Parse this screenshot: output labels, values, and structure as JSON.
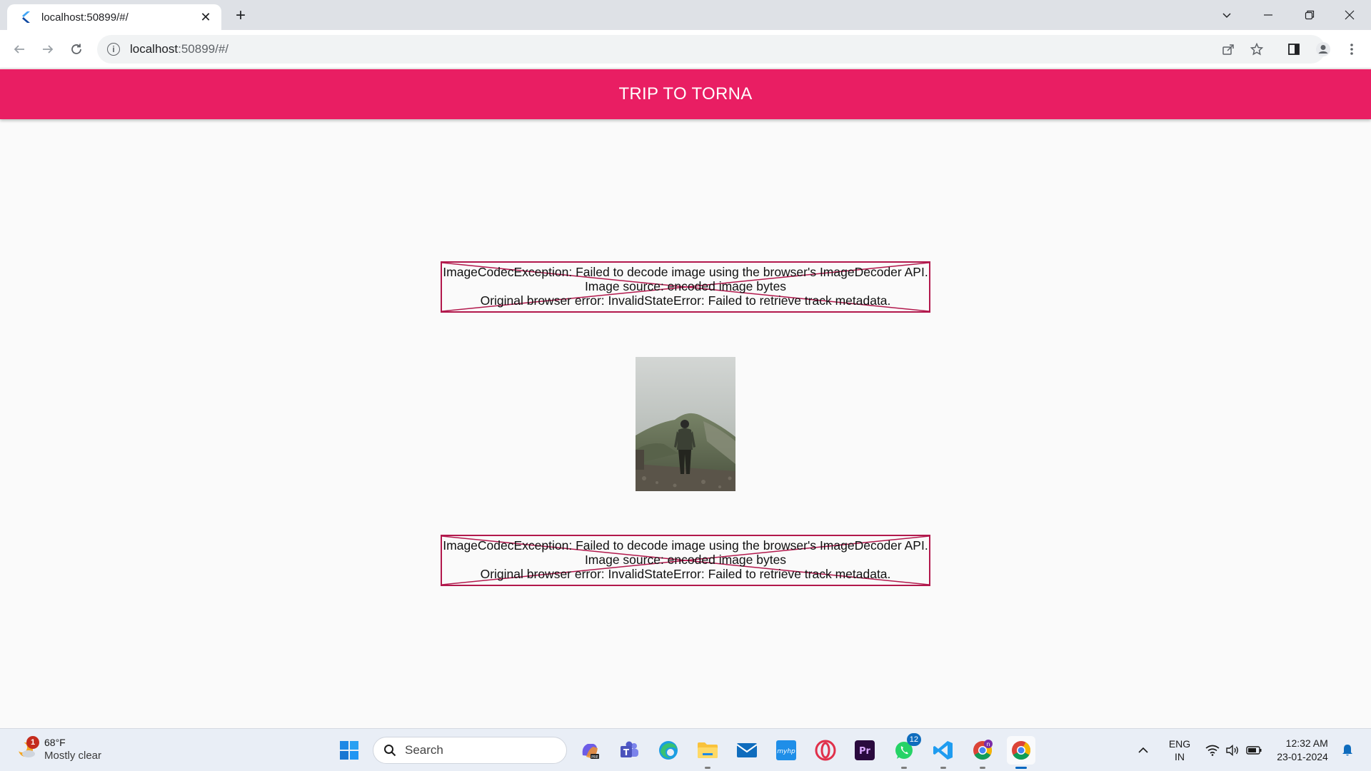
{
  "browser": {
    "tab_title": "localhost:50899/#/",
    "tab_close": "✕",
    "new_tab": "+",
    "url_host": "localhost",
    "url_rest": ":50899/#/"
  },
  "app": {
    "title": "TRIP TO TORNA",
    "accent_color": "#e91e63"
  },
  "errors": [
    {
      "line1": "ImageCodecException: Failed to decode image using the browser's ImageDecoder API.",
      "line2": "Image source: encoded image bytes",
      "line3": "Original browser error: InvalidStateError: Failed to retrieve track metadata."
    },
    {
      "line1": "ImageCodecException: Failed to decode image using the browser's ImageDecoder API.",
      "line2": "Image source: encoded image bytes",
      "line3": "Original browser error: InvalidStateError: Failed to retrieve track metadata."
    }
  ],
  "taskbar": {
    "weather_badge": "1",
    "weather_temp": "68°F",
    "weather_desc": "Mostly clear",
    "search_placeholder": "Search",
    "whatsapp_badge": "12",
    "lang_line1": "ENG",
    "lang_line2": "IN",
    "time": "12:32 AM",
    "date": "23-01-2024"
  }
}
